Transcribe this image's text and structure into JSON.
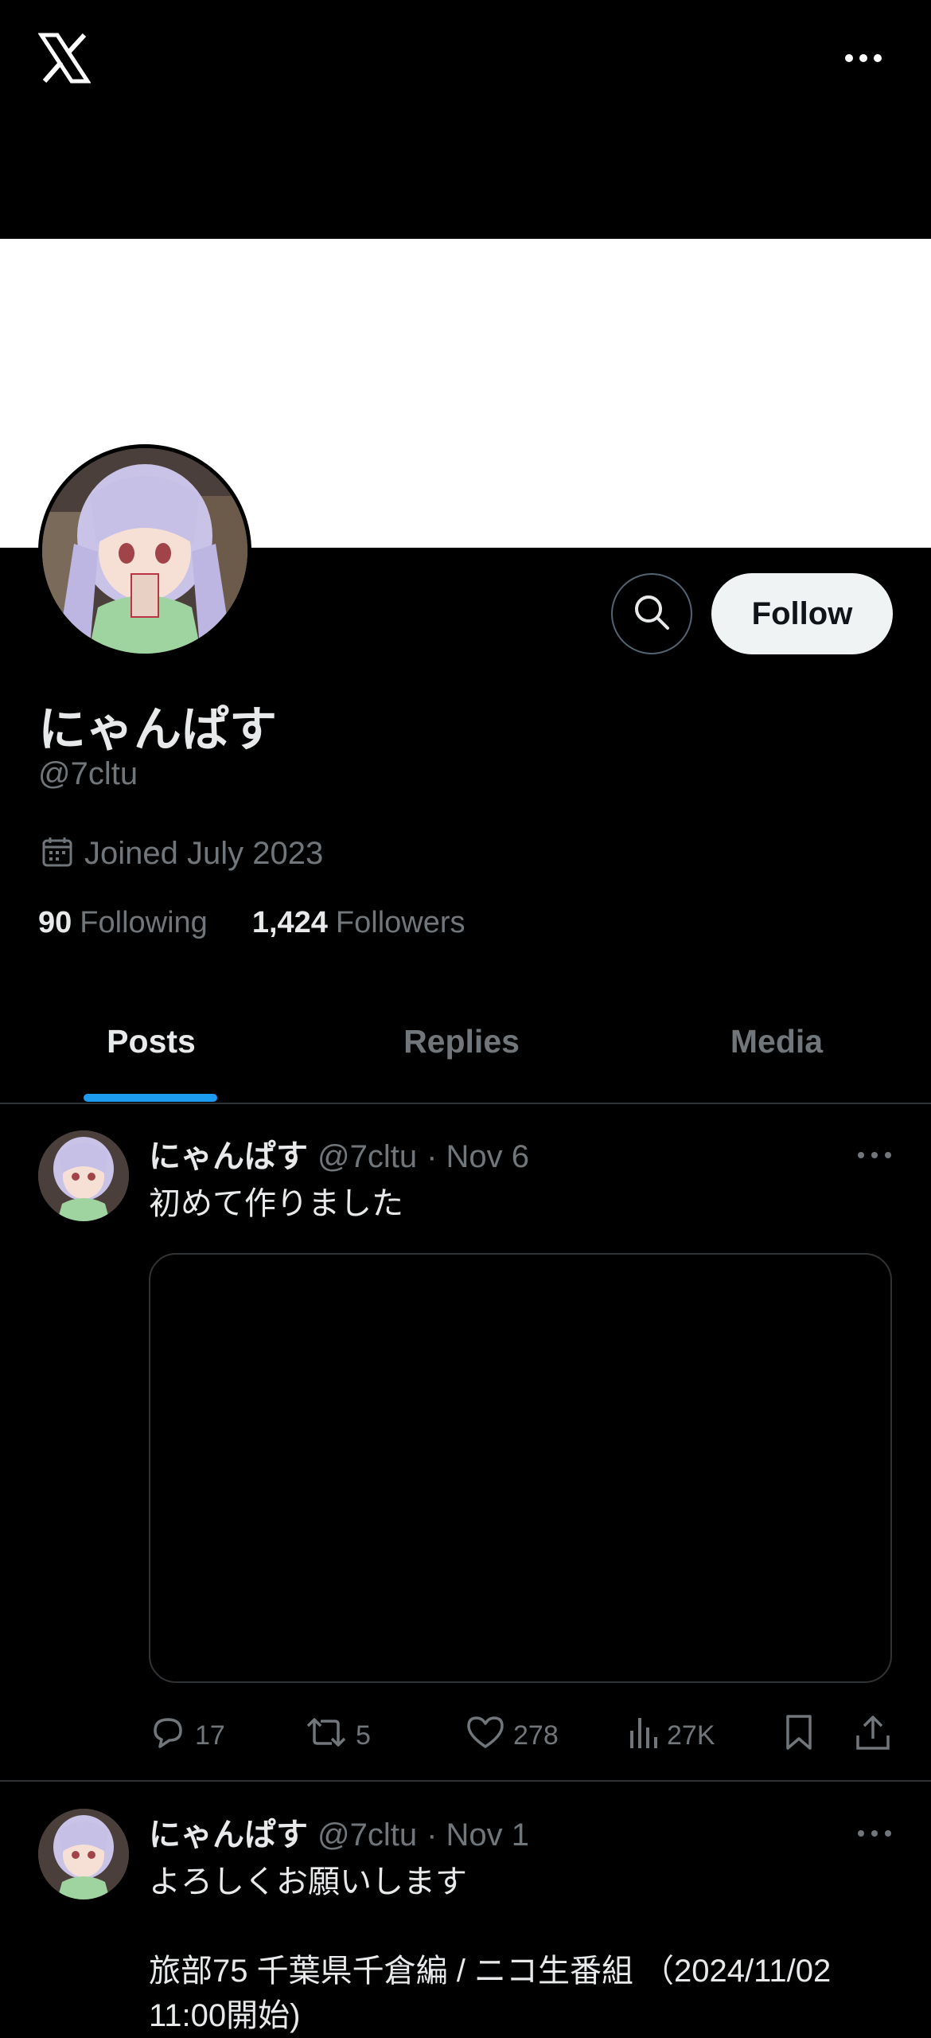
{
  "profile": {
    "display_name": "にゃんぱす",
    "handle": "@7cltu",
    "joined": "Joined July 2023",
    "following_count": "90",
    "following_label": "Following",
    "followers_count": "1,424",
    "followers_label": "Followers",
    "follow_label": "Follow"
  },
  "tabs": [
    {
      "label": "Posts",
      "active": true
    },
    {
      "label": "Replies",
      "active": false
    },
    {
      "label": "Media",
      "active": false
    }
  ],
  "posts": [
    {
      "name": "にゃんぱす",
      "handle": "@7cltu",
      "date": "· Nov 6",
      "text": "初めて作りました",
      "replies": "17",
      "reposts": "5",
      "likes": "278",
      "views": "27K"
    },
    {
      "name": "にゃんぱす",
      "handle": "@7cltu",
      "date": "· Nov 1",
      "text_line1": "よろしくお願いします",
      "text_line2": "旅部75 千葉県千倉編 / ニコ生番組 （2024/11/02",
      "text_line3": "11:00開始)"
    }
  ],
  "colors": {
    "background": "#000000",
    "accent": "#1d9bf0",
    "muted_text": "#71767b",
    "divider": "#2f3336"
  },
  "icons": [
    "x-logo-icon",
    "more-icon",
    "search-icon",
    "calendar-icon",
    "reply-icon",
    "repost-icon",
    "like-icon",
    "views-icon",
    "bookmark-icon",
    "share-icon"
  ]
}
